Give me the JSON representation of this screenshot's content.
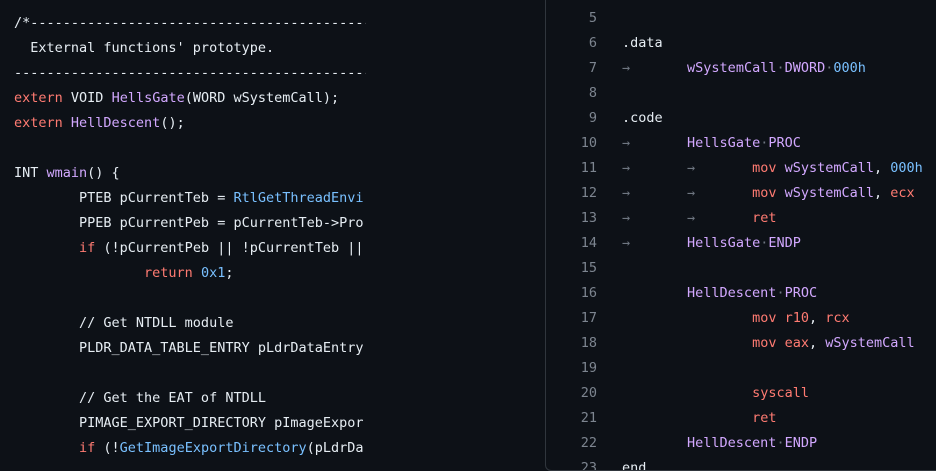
{
  "left_code": {
    "l1": "/*-----------------------------------------------",
    "l2": "  External functions' prototype.",
    "l3": "--------------------------------------------------",
    "l4_kw": "extern",
    "l4_type": " VOID ",
    "l4_fn": "HellsGate",
    "l4_rest": "(WORD wSystemCall);",
    "l5_kw": "extern",
    "l5_fn": " HellDescent",
    "l5_rest": "();",
    "l7_type": "INT ",
    "l7_fn": "wmain",
    "l7_rest": "() {",
    "l8_a": "        PTEB pCurrentTeb = ",
    "l8_api": "RtlGetThreadEnvi",
    "l9": "        PPEB pCurrentPeb = pCurrentTeb->Pro",
    "l10_kw": "        if",
    "l10_rest": " (!pCurrentPeb || !pCurrentTeb ||",
    "l11_kw": "                return",
    "l11_num": " 0x1",
    "l11_rest": ";",
    "l13": "        // Get NTDLL module",
    "l14": "        PLDR_DATA_TABLE_ENTRY pLdrDataEntry",
    "l16": "        // Get the EAT of NTDLL",
    "l17": "        PIMAGE_EXPORT_DIRECTORY pImageExpor",
    "l18_kw": "        if",
    "l18_a": " (!",
    "l18_api": "GetImageExportDirectory",
    "l18_rest": "(pLdrDa"
  },
  "asm": {
    "lines": [
      {
        "n": "5"
      },
      {
        "n": "6",
        "t": ".data"
      },
      {
        "n": "7",
        "arrow1": "→",
        "ident": "wSystemCall",
        "dir": "DWORD",
        "num": "000h"
      },
      {
        "n": "8"
      },
      {
        "n": "9",
        "t": ".code"
      },
      {
        "n": "10",
        "arrow1": "→",
        "ident": "HellsGate",
        "dir": "PROC"
      },
      {
        "n": "11",
        "arrow1": "→",
        "arrow2": "→",
        "op": "mov",
        "a1": "wSystemCall",
        "a2": "000h"
      },
      {
        "n": "12",
        "arrow1": "→",
        "arrow2": "→",
        "op": "mov",
        "a1": "wSystemCall",
        "a2": "ecx"
      },
      {
        "n": "13",
        "arrow1": "→",
        "arrow2": "→",
        "op": "ret"
      },
      {
        "n": "14",
        "arrow1": "→",
        "ident": "HellsGate",
        "dir": "ENDP"
      },
      {
        "n": "15"
      },
      {
        "n": "16",
        "ident": "HellDescent",
        "dir": "PROC"
      },
      {
        "n": "17",
        "op": "mov",
        "a1": "r10",
        "a2": "rcx"
      },
      {
        "n": "18",
        "op": "mov",
        "a1": "eax",
        "a2": "wSystemCall"
      },
      {
        "n": "19"
      },
      {
        "n": "20",
        "op": "syscall"
      },
      {
        "n": "21",
        "op": "ret"
      },
      {
        "n": "22",
        "ident": "HellDescent",
        "dir": "ENDP"
      },
      {
        "n": "23",
        "t": "end"
      }
    ]
  }
}
